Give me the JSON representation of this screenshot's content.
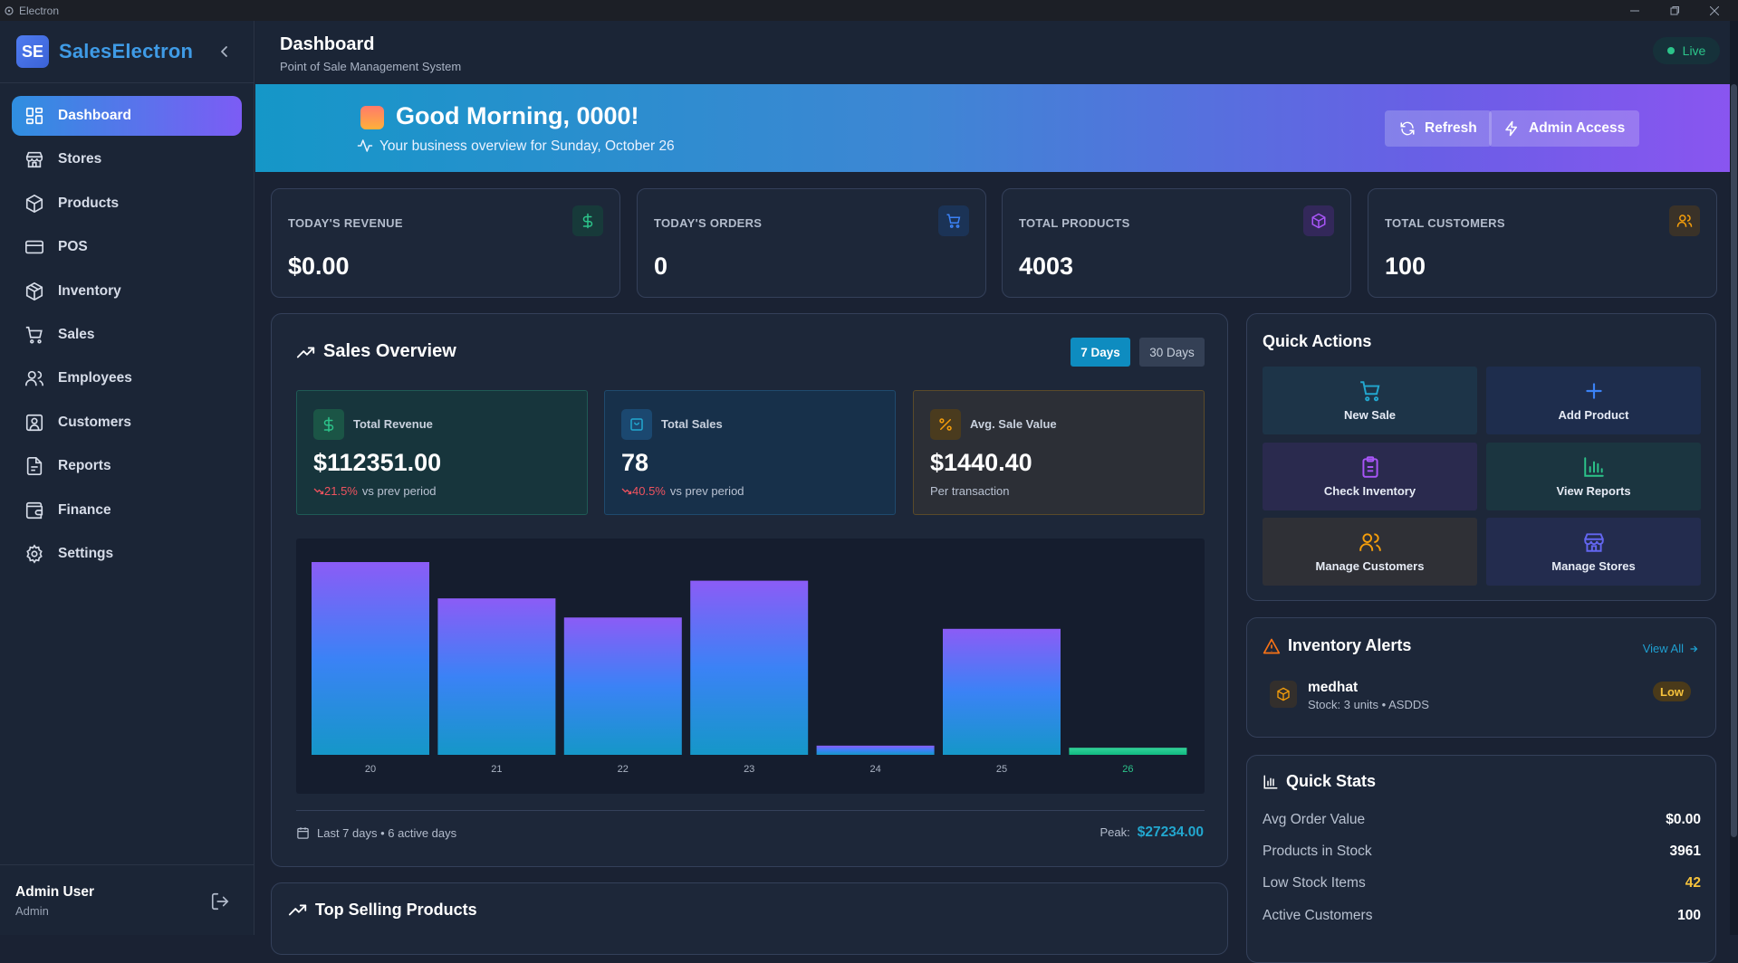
{
  "window": {
    "title": "Electron"
  },
  "sidebar": {
    "logo": "SE",
    "brand": "SalesElectron",
    "items": [
      {
        "label": "Dashboard",
        "icon": "dashboard-icon",
        "active": true
      },
      {
        "label": "Stores",
        "icon": "store-icon"
      },
      {
        "label": "Products",
        "icon": "box-icon"
      },
      {
        "label": "POS",
        "icon": "credit-card-icon"
      },
      {
        "label": "Inventory",
        "icon": "package-icon"
      },
      {
        "label": "Sales",
        "icon": "cart-icon"
      },
      {
        "label": "Employees",
        "icon": "users-icon"
      },
      {
        "label": "Customers",
        "icon": "contact-icon"
      },
      {
        "label": "Reports",
        "icon": "report-icon"
      },
      {
        "label": "Finance",
        "icon": "wallet-icon"
      },
      {
        "label": "Settings",
        "icon": "gear-icon"
      }
    ],
    "user": {
      "name": "Admin User",
      "role": "Admin"
    }
  },
  "header": {
    "title": "Dashboard",
    "subtitle": "Point of Sale Management System",
    "status": "Live"
  },
  "banner": {
    "greeting": "Good Morning, 0000!",
    "overview": "Your business overview for Sunday, October 26",
    "refresh_label": "Refresh",
    "admin_label": "Admin Access"
  },
  "stats": [
    {
      "label": "TODAY'S REVENUE",
      "value": "$0.00",
      "icon": "dollar-icon",
      "color": "#2cc48a"
    },
    {
      "label": "TODAY'S ORDERS",
      "value": "0",
      "icon": "cart-icon",
      "color": "#3b82f6"
    },
    {
      "label": "TOTAL PRODUCTS",
      "value": "4003",
      "icon": "box-icon",
      "color": "#a855f7"
    },
    {
      "label": "TOTAL CUSTOMERS",
      "value": "100",
      "icon": "users-icon",
      "color": "#f59e0b"
    }
  ],
  "sales_overview": {
    "title": "Sales Overview",
    "range_7": "7 Days",
    "range_30": "30 Days",
    "metrics": {
      "revenue": {
        "label": "Total Revenue",
        "value": "$112351.00",
        "change": "21.5%",
        "change_note": "vs prev period"
      },
      "sales": {
        "label": "Total Sales",
        "value": "78",
        "change": "40.5%",
        "change_note": "vs prev period"
      },
      "avg": {
        "label": "Avg. Sale Value",
        "value": "$1440.40",
        "note": "Per transaction"
      }
    },
    "footer_left": "Last 7 days • 6 active days",
    "peak_label": "Peak:",
    "peak_value": "$27234.00"
  },
  "chart_data": {
    "type": "bar",
    "categories": [
      "20",
      "21",
      "22",
      "23",
      "24",
      "25",
      "26"
    ],
    "values": [
      27234,
      22100,
      19400,
      24600,
      1300,
      17800,
      1000
    ],
    "highlight_category": "26",
    "ylim": [
      0,
      27234
    ],
    "grid": false
  },
  "top_selling": {
    "title": "Top Selling Products"
  },
  "quick_actions": {
    "title": "Quick Actions",
    "items": [
      {
        "label": "New Sale",
        "icon": "cart-icon",
        "color": "#22a7cf"
      },
      {
        "label": "Add Product",
        "icon": "plus-icon",
        "color": "#3b82f6"
      },
      {
        "label": "Check Inventory",
        "icon": "clipboard-icon",
        "color": "#a855f7"
      },
      {
        "label": "View Reports",
        "icon": "bar-chart-icon",
        "color": "#2cc48a"
      },
      {
        "label": "Manage Customers",
        "icon": "users-icon",
        "color": "#f59e0b"
      },
      {
        "label": "Manage Stores",
        "icon": "store-icon",
        "color": "#6366f1"
      }
    ]
  },
  "inventory_alerts": {
    "title": "Inventory Alerts",
    "view_all": "View All",
    "items": [
      {
        "name": "medhat",
        "meta": "Stock: 3 units • ASDDS",
        "badge": "Low"
      }
    ]
  },
  "quick_stats": {
    "title": "Quick Stats",
    "rows": [
      {
        "label": "Avg Order Value",
        "value": "$0.00"
      },
      {
        "label": "Products in Stock",
        "value": "3961"
      },
      {
        "label": "Low Stock Items",
        "value": "42"
      },
      {
        "label": "Active Customers",
        "value": "100"
      }
    ]
  }
}
